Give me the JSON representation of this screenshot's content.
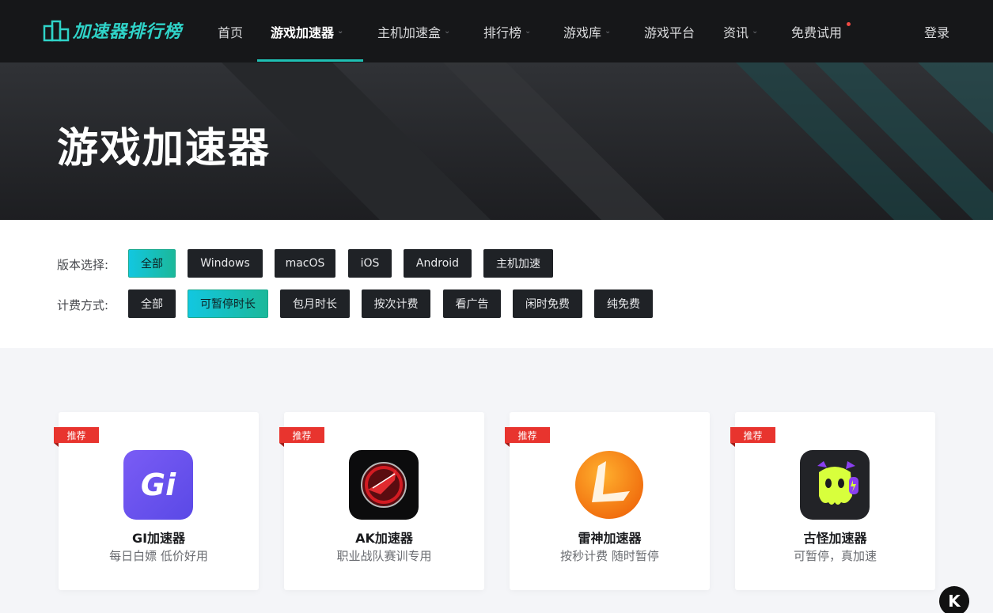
{
  "nav": {
    "logo_text": "加速器排行榜",
    "items": [
      {
        "label": "首页"
      },
      {
        "label": "游戏加速器"
      },
      {
        "label": "主机加速盒"
      },
      {
        "label": "排行榜"
      },
      {
        "label": "游戏库"
      },
      {
        "label": "游戏平台"
      },
      {
        "label": "资讯"
      },
      {
        "label": "免费试用"
      }
    ],
    "login": "登录",
    "accent_color": "#1fc0b4"
  },
  "hero": {
    "title": "游戏加速器"
  },
  "filters": {
    "version_label": "版本选择:",
    "version_options": [
      "全部",
      "Windows",
      "macOS",
      "iOS",
      "Android",
      "主机加速"
    ],
    "version_selected": "全部",
    "billing_label": "计费方式:",
    "billing_options": [
      "全部",
      "可暂停时长",
      "包月时长",
      "按次计费",
      "看广告",
      "闲时免费",
      "纯免费"
    ],
    "billing_selected": "可暂停时长"
  },
  "cards": [
    {
      "tag": "推荐",
      "name": "GI加速器",
      "desc": "每日白嫖 低价好用",
      "icon": "gi-logo-icon",
      "icon_text": "Gi"
    },
    {
      "tag": "推荐",
      "name": "AK加速器",
      "desc": "职业战队赛训专用",
      "icon": "ak-logo-icon"
    },
    {
      "tag": "推荐",
      "name": "雷神加速器",
      "desc": "按秒计费 随时暂停",
      "icon": "leishen-logo-icon"
    },
    {
      "tag": "推荐",
      "name": "古怪加速器",
      "desc": "可暂停，真加速",
      "icon": "guguai-logo-icon"
    }
  ],
  "float_button": {
    "label": "K"
  }
}
